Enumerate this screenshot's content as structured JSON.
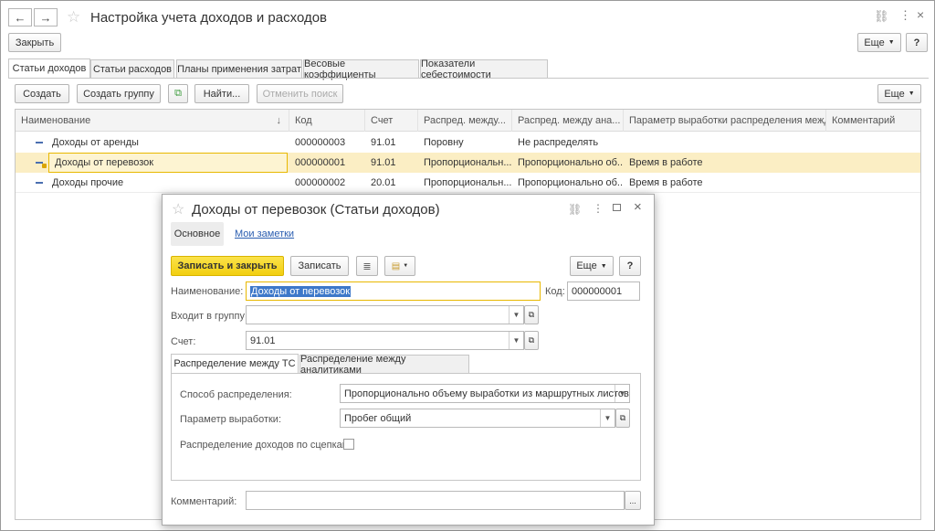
{
  "window": {
    "title": "Настройка учета доходов и расходов",
    "close_label": "Закрыть",
    "more_label": "Еще",
    "help_label": "?"
  },
  "tabs": [
    {
      "label": "Статьи доходов"
    },
    {
      "label": "Статьи расходов"
    },
    {
      "label": "Планы применения затрат"
    },
    {
      "label": "Весовые коэффициенты"
    },
    {
      "label": "Показатели себестоимости"
    }
  ],
  "toolbar": {
    "create_label": "Создать",
    "create_group_label": "Создать группу",
    "find_label": "Найти...",
    "cancel_search_label": "Отменить поиск",
    "more_label": "Еще"
  },
  "table": {
    "columns": [
      "Наименование",
      "Код",
      "Счет",
      "Распред. между...",
      "Распред. между ана...",
      "Параметр выработки распределения межд...",
      "Комментарий"
    ],
    "sort_indicator": "↓",
    "rows": [
      {
        "name": "Доходы от аренды",
        "code": "000000003",
        "account": "91.01",
        "dist_ts": "Поровну",
        "dist_an": "Не распределять",
        "param": "",
        "comment": ""
      },
      {
        "name": "Доходы от перевозок",
        "code": "000000001",
        "account": "91.01",
        "dist_ts": "Пропорциональн...",
        "dist_an": "Пропорционально об...",
        "param": "Время в работе",
        "comment": ""
      },
      {
        "name": "Доходы прочие",
        "code": "000000002",
        "account": "20.01",
        "dist_ts": "Пропорциональн...",
        "dist_an": "Пропорционально об...",
        "param": "Время в работе",
        "comment": ""
      }
    ]
  },
  "dialog": {
    "title": "Доходы от перевозок (Статьи доходов)",
    "nav_main": "Основное",
    "nav_notes": "Мои заметки",
    "save_close_label": "Записать и закрыть",
    "save_label": "Записать",
    "more_label": "Еще",
    "help_label": "?",
    "name_label": "Наименование:",
    "name_value": "Доходы от перевозок",
    "code_label": "Код:",
    "code_value": "000000001",
    "group_label": "Входит в группу:",
    "group_value": "",
    "account_label": "Счет:",
    "account_value": "91.01",
    "subtabs": [
      {
        "label": "Распределение между ТС"
      },
      {
        "label": "Распределение между аналитиками"
      }
    ],
    "method_label": "Способ распределения:",
    "method_value": "Пропорционально объему выработки из маршрутных листов",
    "param_label": "Параметр выработки:",
    "param_value": "Пробег общий",
    "hitch_label": "Распределение доходов по сцепкам:",
    "comment_label": "Комментарий:",
    "comment_value": "",
    "comment_btn": "..."
  },
  "colors": {
    "accent_yellow": "#f5d31c",
    "selected_row": "#fbeec4",
    "link_blue": "#2a5db0"
  }
}
